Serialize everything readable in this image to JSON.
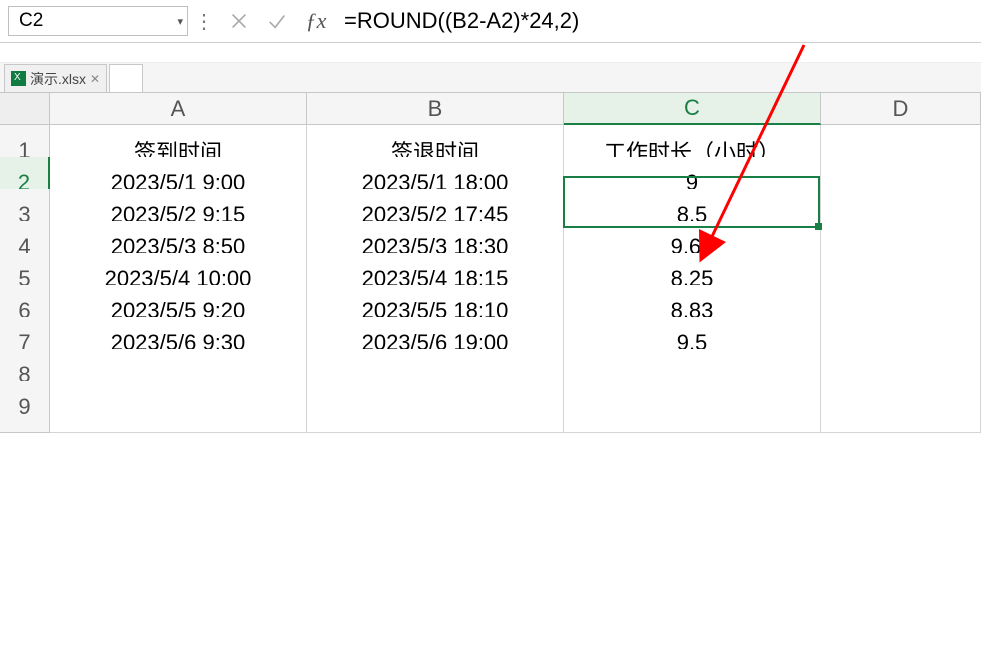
{
  "formula_bar": {
    "name_box": "C2",
    "formula": "=ROUND((B2-A2)*24,2)"
  },
  "file_tab": {
    "name": "演示.xlsx"
  },
  "columns": [
    "A",
    "B",
    "C",
    "D"
  ],
  "headers": {
    "A": "签到时间",
    "B": "签退时间",
    "C": "工作时长（小时）"
  },
  "rows": [
    {
      "n": "1"
    },
    {
      "n": "2",
      "A": "2023/5/1 9:00",
      "B": "2023/5/1 18:00",
      "C": "9"
    },
    {
      "n": "3",
      "A": "2023/5/2 9:15",
      "B": "2023/5/2 17:45",
      "C": "8.5"
    },
    {
      "n": "4",
      "A": "2023/5/3 8:50",
      "B": "2023/5/3 18:30",
      "C": "9.67"
    },
    {
      "n": "5",
      "A": "2023/5/4 10:00",
      "B": "2023/5/4 18:15",
      "C": "8.25"
    },
    {
      "n": "6",
      "A": "2023/5/5 9:20",
      "B": "2023/5/5 18:10",
      "C": "8.83"
    },
    {
      "n": "7",
      "A": "2023/5/6 9:30",
      "B": "2023/5/6 19:00",
      "C": "9.5"
    },
    {
      "n": "8"
    },
    {
      "n": "9"
    }
  ],
  "selection": {
    "col": "C",
    "row": "2"
  },
  "chart_data": {
    "type": "table",
    "title": "",
    "columns": [
      "签到时间",
      "签退时间",
      "工作时长（小时）"
    ],
    "rows": [
      [
        "2023/5/1 9:00",
        "2023/5/1 18:00",
        9
      ],
      [
        "2023/5/2 9:15",
        "2023/5/2 17:45",
        8.5
      ],
      [
        "2023/5/3 8:50",
        "2023/5/3 18:30",
        9.67
      ],
      [
        "2023/5/4 10:00",
        "2023/5/4 18:15",
        8.25
      ],
      [
        "2023/5/5 9:20",
        "2023/5/5 18:10",
        8.83
      ],
      [
        "2023/5/6 9:30",
        "2023/5/6 19:00",
        9.5
      ]
    ]
  }
}
